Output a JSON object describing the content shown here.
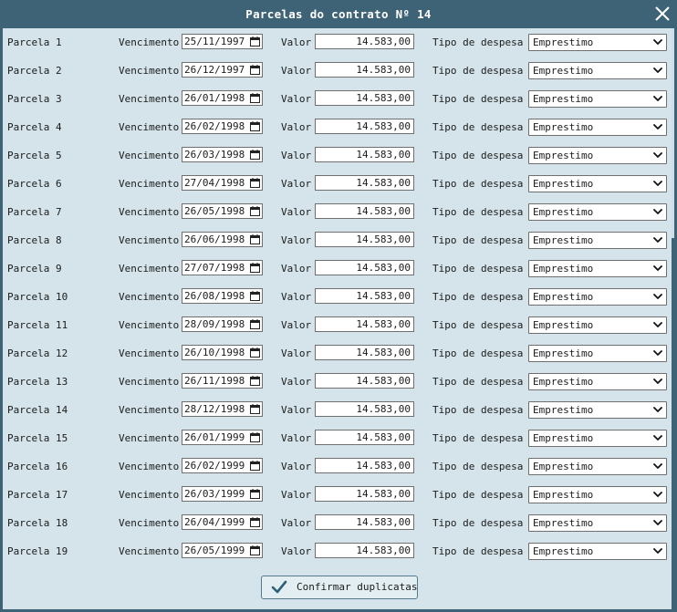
{
  "window": {
    "title": "Parcelas do contrato Nº 14"
  },
  "labels": {
    "vencimento": "Vencimento",
    "valor": "Valor",
    "tipo_despesa": "Tipo de despesa"
  },
  "parcelas": [
    {
      "label": "Parcela 1",
      "vencimento": "25/11/1997",
      "valor": "14.583,00",
      "tipo": "Emprestimo"
    },
    {
      "label": "Parcela 2",
      "vencimento": "26/12/1997",
      "valor": "14.583,00",
      "tipo": "Emprestimo"
    },
    {
      "label": "Parcela 3",
      "vencimento": "26/01/1998",
      "valor": "14.583,00",
      "tipo": "Emprestimo"
    },
    {
      "label": "Parcela 4",
      "vencimento": "26/02/1998",
      "valor": "14.583,00",
      "tipo": "Emprestimo"
    },
    {
      "label": "Parcela 5",
      "vencimento": "26/03/1998",
      "valor": "14.583,00",
      "tipo": "Emprestimo"
    },
    {
      "label": "Parcela 6",
      "vencimento": "27/04/1998",
      "valor": "14.583,00",
      "tipo": "Emprestimo"
    },
    {
      "label": "Parcela 7",
      "vencimento": "26/05/1998",
      "valor": "14.583,00",
      "tipo": "Emprestimo"
    },
    {
      "label": "Parcela 8",
      "vencimento": "26/06/1998",
      "valor": "14.583,00",
      "tipo": "Emprestimo"
    },
    {
      "label": "Parcela 9",
      "vencimento": "27/07/1998",
      "valor": "14.583,00",
      "tipo": "Emprestimo"
    },
    {
      "label": "Parcela 10",
      "vencimento": "26/08/1998",
      "valor": "14.583,00",
      "tipo": "Emprestimo"
    },
    {
      "label": "Parcela 11",
      "vencimento": "28/09/1998",
      "valor": "14.583,00",
      "tipo": "Emprestimo"
    },
    {
      "label": "Parcela 12",
      "vencimento": "26/10/1998",
      "valor": "14.583,00",
      "tipo": "Emprestimo"
    },
    {
      "label": "Parcela 13",
      "vencimento": "26/11/1998",
      "valor": "14.583,00",
      "tipo": "Emprestimo"
    },
    {
      "label": "Parcela 14",
      "vencimento": "28/12/1998",
      "valor": "14.583,00",
      "tipo": "Emprestimo"
    },
    {
      "label": "Parcela 15",
      "vencimento": "26/01/1999",
      "valor": "14.583,00",
      "tipo": "Emprestimo"
    },
    {
      "label": "Parcela 16",
      "vencimento": "26/02/1999",
      "valor": "14.583,00",
      "tipo": "Emprestimo"
    },
    {
      "label": "Parcela 17",
      "vencimento": "26/03/1999",
      "valor": "14.583,00",
      "tipo": "Emprestimo"
    },
    {
      "label": "Parcela 18",
      "vencimento": "26/04/1999",
      "valor": "14.583,00",
      "tipo": "Emprestimo"
    },
    {
      "label": "Parcela 19",
      "vencimento": "26/05/1999",
      "valor": "14.583,00",
      "tipo": "Emprestimo"
    }
  ],
  "confirm_button": {
    "label": "Confirmar duplicatas"
  },
  "icons": {
    "close": "close-icon",
    "calendar": "calendar-icon",
    "dropdown": "chevron-down-icon",
    "confirm": "check-icon"
  },
  "colors": {
    "title_bar": "#3f6376",
    "panel": "#d4e4ea",
    "accent": "#2d5f78"
  }
}
